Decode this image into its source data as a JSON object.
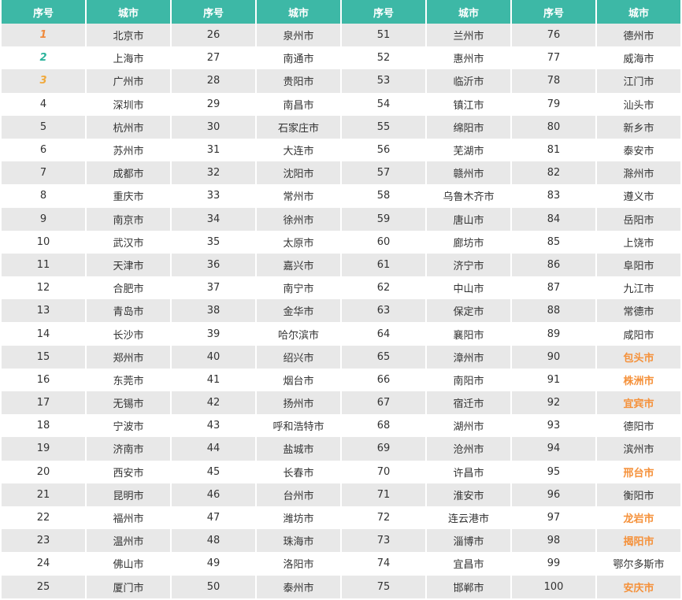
{
  "table": {
    "headers": [
      "序号",
      "城市",
      "序号",
      "城市",
      "序号",
      "城市",
      "序号",
      "城市"
    ],
    "highlight_color": "#f5913a",
    "header_color": "#3db8a6",
    "highlighted_cities": [
      "包头市",
      "株洲市",
      "宜宾市",
      "邢台市",
      "龙岩市",
      "揭阳市",
      "安庆市"
    ],
    "rows": [
      [
        "1",
        "北京市",
        "26",
        "泉州市",
        "51",
        "兰州市",
        "76",
        "德州市"
      ],
      [
        "2",
        "上海市",
        "27",
        "南通市",
        "52",
        "惠州市",
        "77",
        "威海市"
      ],
      [
        "3",
        "广州市",
        "28",
        "贵阳市",
        "53",
        "临沂市",
        "78",
        "江门市"
      ],
      [
        "4",
        "深圳市",
        "29",
        "南昌市",
        "54",
        "镇江市",
        "79",
        "汕头市"
      ],
      [
        "5",
        "杭州市",
        "30",
        "石家庄市",
        "55",
        "绵阳市",
        "80",
        "新乡市"
      ],
      [
        "6",
        "苏州市",
        "31",
        "大连市",
        "56",
        "芜湖市",
        "81",
        "泰安市"
      ],
      [
        "7",
        "成都市",
        "32",
        "沈阳市",
        "57",
        "赣州市",
        "82",
        "滁州市"
      ],
      [
        "8",
        "重庆市",
        "33",
        "常州市",
        "58",
        "乌鲁木齐市",
        "83",
        "遵义市"
      ],
      [
        "9",
        "南京市",
        "34",
        "徐州市",
        "59",
        "唐山市",
        "84",
        "岳阳市"
      ],
      [
        "10",
        "武汉市",
        "35",
        "太原市",
        "60",
        "廊坊市",
        "85",
        "上饶市"
      ],
      [
        "11",
        "天津市",
        "36",
        "嘉兴市",
        "61",
        "济宁市",
        "86",
        "阜阳市"
      ],
      [
        "12",
        "合肥市",
        "37",
        "南宁市",
        "62",
        "中山市",
        "87",
        "九江市"
      ],
      [
        "13",
        "青岛市",
        "38",
        "金华市",
        "63",
        "保定市",
        "88",
        "常德市"
      ],
      [
        "14",
        "长沙市",
        "39",
        "哈尔滨市",
        "64",
        "襄阳市",
        "89",
        "咸阳市"
      ],
      [
        "15",
        "郑州市",
        "40",
        "绍兴市",
        "65",
        "漳州市",
        "90",
        "包头市"
      ],
      [
        "16",
        "东莞市",
        "41",
        "烟台市",
        "66",
        "南阳市",
        "91",
        "株洲市"
      ],
      [
        "17",
        "无锡市",
        "42",
        "扬州市",
        "67",
        "宿迁市",
        "92",
        "宜宾市"
      ],
      [
        "18",
        "宁波市",
        "43",
        "呼和浩特市",
        "68",
        "湖州市",
        "93",
        "德阳市"
      ],
      [
        "19",
        "济南市",
        "44",
        "盐城市",
        "69",
        "沧州市",
        "94",
        "滨州市"
      ],
      [
        "20",
        "西安市",
        "45",
        "长春市",
        "70",
        "许昌市",
        "95",
        "邢台市"
      ],
      [
        "21",
        "昆明市",
        "46",
        "台州市",
        "71",
        "淮安市",
        "96",
        "衡阳市"
      ],
      [
        "22",
        "福州市",
        "47",
        "潍坊市",
        "72",
        "连云港市",
        "97",
        "龙岩市"
      ],
      [
        "23",
        "温州市",
        "48",
        "珠海市",
        "73",
        "淄博市",
        "98",
        "揭阳市"
      ],
      [
        "24",
        "佛山市",
        "49",
        "洛阳市",
        "74",
        "宜昌市",
        "99",
        "鄂尔多斯市"
      ],
      [
        "25",
        "厦门市",
        "50",
        "泰州市",
        "75",
        "邯郸市",
        "100",
        "安庆市"
      ]
    ]
  }
}
